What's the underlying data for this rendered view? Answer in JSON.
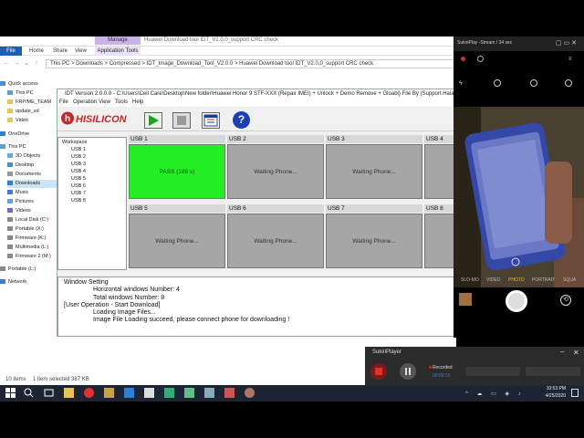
{
  "explorer": {
    "title": "Huawei Download tool IDT_V2.0.0_support CRC check",
    "manage_tab": "Manage",
    "tabs": [
      "File",
      "Home",
      "Share",
      "View",
      "Application Tools"
    ],
    "address": "This PC  >  Downloads  >  Compressed  >  IDT_Image_Download_Tool_V2.0.0  >  Huawei Download tool IDT_V2.0.0_support CRC check",
    "nav_items": [
      "Quick access",
      "This PC",
      "FRP/ME_TEAM",
      "update_sd",
      "Video",
      "OneDrive",
      "This PC",
      "3D Objects",
      "Desktop",
      "Documents",
      "Downloads",
      "Music",
      "Pictures",
      "Videos",
      "Local Disk (C:)",
      "Portable (X:)",
      "Firmware (K:)",
      "Multimedia (L:)",
      "Firmware 2 (M:)",
      "Portable (L:)",
      "Network"
    ],
    "status_items": "10 items",
    "status_selected": "1 item selected  387 KB"
  },
  "idt": {
    "title": "IDT Version 2.0.0.0 - C:\\Users\\Cell Care\\Desktop\\New folder\\Huawei Honor 9 STF-XXX (Repair IMEI) + Unlock + Demo Remove + Gloabl) File By (Support.HalabTech.Com)\\HTT\\FRP\\M",
    "menu": [
      "File",
      "Operation",
      "View",
      "Tools",
      "Help"
    ],
    "logo_text": "HISILICON",
    "workspace_label": "Workspace",
    "tree": [
      "USB 1",
      "USB 2",
      "USB 3",
      "USB 4",
      "USB 5",
      "USB 6",
      "USB 7",
      "USB 8"
    ],
    "cells": [
      {
        "head": "USB 1",
        "status": "PASS (186 s)",
        "pass": true
      },
      {
        "head": "USB 2",
        "status": "Waiting Phone...",
        "pass": false
      },
      {
        "head": "USB 3",
        "status": "Waiting Phone...",
        "pass": false
      },
      {
        "head": "USB 4",
        "status": "",
        "pass": false
      },
      {
        "head": "USB 5",
        "status": "Waiting Phone...",
        "pass": false
      },
      {
        "head": "USB 6",
        "status": "Waiting Phone...",
        "pass": false
      },
      {
        "head": "USB 7",
        "status": "Waiting Phone...",
        "pass": false
      },
      {
        "head": "USB 8",
        "status": "",
        "pass": false
      }
    ],
    "log": [
      "Window Setting",
      "Horizontal windows Number: 4",
      "Total windows Number: 8",
      "[User Operation - Start Download]",
      "Loading Image Files...",
      "Image File Loading succeed, please connect phone for downloading !"
    ]
  },
  "camera": {
    "top_text": "SukiriPlay  -Stream /  34 sec",
    "modes": [
      "SLO-MO",
      "VIDEO",
      "PHOTO",
      "PORTRAIT",
      "SQUA"
    ]
  },
  "recorder": {
    "title": "SukiriPlayer",
    "state": "Recorded",
    "time": "00:09:15"
  },
  "taskbar": {
    "time": "10:53 PM",
    "date": "4/25/2020"
  },
  "colors": {
    "pass": "#22ee22",
    "waiting": "#a6a6a6",
    "accent": "#1a5fb4"
  }
}
